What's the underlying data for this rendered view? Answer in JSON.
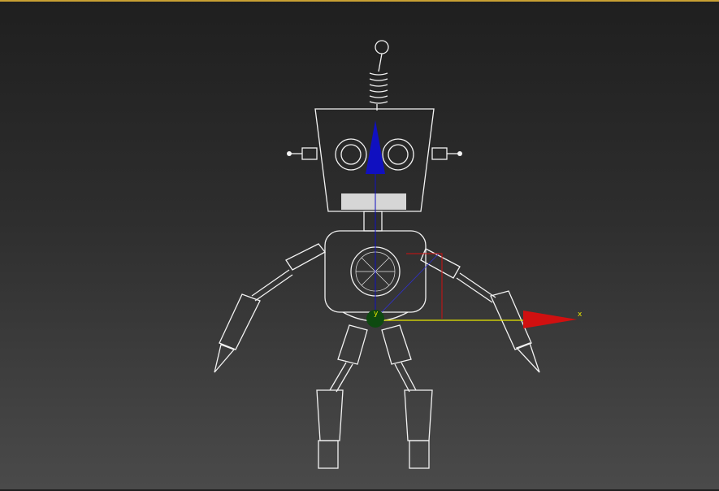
{
  "viewport": {
    "frame_color": "#c9a033",
    "background_top": "#1f1f1f",
    "background_bottom": "#4a4a4a"
  },
  "model": {
    "wire_color": "#f2f2f2"
  },
  "gizmo": {
    "x_label": "x",
    "y_label": "y",
    "x_color": "#d01010",
    "y_color": "#e6e600",
    "z_color": "#1010c0",
    "center_color": "#0e4a10"
  }
}
